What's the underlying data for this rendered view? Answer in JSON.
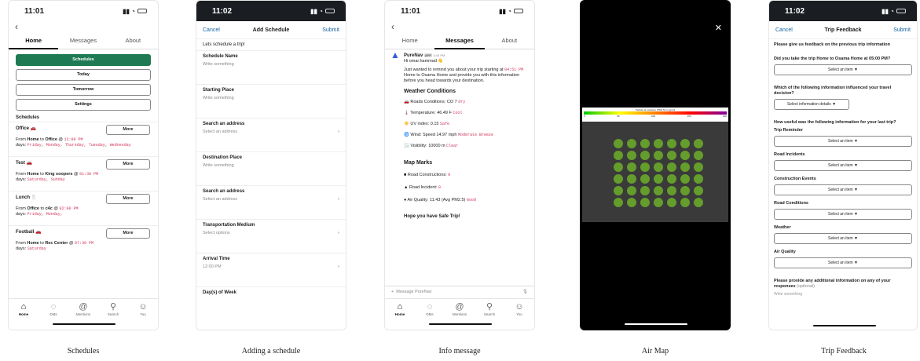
{
  "captions": [
    "Schedules",
    "Adding a schedule",
    "Info message",
    "Air Map",
    "Trip Feedback"
  ],
  "screen1": {
    "time": "11:01",
    "tabs": [
      "Home",
      "Messages",
      "About"
    ],
    "buttons": [
      "Schedules",
      "Today",
      "Tomorrow",
      "Settings"
    ],
    "section": "Schedules",
    "more": "More",
    "items": [
      {
        "title": "Office 🚗",
        "from": "From ",
        "a": "Home",
        "to": " to ",
        "b": "Office",
        "at": " @ ",
        "time": "12:00 PM",
        "days": "Friday, Monday, Thursday, Tuesday, Wednesday"
      },
      {
        "title": "Test 🚗",
        "from": "From ",
        "a": "Home",
        "to": " to ",
        "b": "King soopers",
        "at": " @ ",
        "time": "01:30 PM",
        "days": "Saturday, Sunday"
      },
      {
        "title": "Lunch 🍴",
        "from": "From ",
        "a": "Office",
        "to": " to ",
        "b": "c4c",
        "at": " @ ",
        "time": "02:00 PM",
        "days": "Friday, Monday,"
      },
      {
        "title": "Football 🚗",
        "from": "From ",
        "a": "Home",
        "to": " to ",
        "b": "Rec Center",
        "at": " @ ",
        "time": "07:30 PM",
        "days": "Saturday"
      }
    ],
    "days_label": "days: "
  },
  "nav": [
    {
      "icon": "home-icon",
      "label": "Home"
    },
    {
      "icon": "dms-icon",
      "label": "DMs"
    },
    {
      "icon": "mentions-icon",
      "label": "Mentions"
    },
    {
      "icon": "search-icon",
      "label": "Search"
    },
    {
      "icon": "you-icon",
      "label": "You"
    }
  ],
  "screen2": {
    "time": "11:02",
    "cancel": "Cancel",
    "title": "Add Schedule",
    "submit": "Submit",
    "intro": "Lets schedule a trip!",
    "fields": [
      {
        "label": "Schedule Name",
        "value": "Write something"
      },
      {
        "label": "Starting Place",
        "value": "Write something"
      },
      {
        "label": "Search an address",
        "value": "Select an address",
        "arrow": true
      },
      {
        "label": "Destination Place",
        "value": "Write something"
      },
      {
        "label": "Search an address",
        "value": "Select an address",
        "arrow": true
      },
      {
        "label": "Transportation Medium",
        "value": "Select options",
        "arrow": true
      },
      {
        "label": "Arrival Time",
        "value": "12:00 PM",
        "arrow": true
      },
      {
        "label": "Day(s) of Week",
        "value": ""
      }
    ]
  },
  "screen3": {
    "time": "11:01",
    "tabs": [
      "Home",
      "Messages",
      "About"
    ],
    "sender": "PureNav",
    "app": "APP",
    "stamp": "4:43 PM",
    "greeting": "Hi omar.hammad 👋",
    "body1": "Just wanted to remind you about your trip starting at ",
    "t": "04:51 PM",
    "body2": " Home to Osama Home and provide you with this information before you head towards your destination.",
    "weather_h": "Weather Conditions",
    "weather": [
      {
        "label": "🚗 Roads Conditions: ",
        "v": "CO 7",
        "tag": "dry"
      },
      {
        "label": "🌡️ Temperature: ",
        "v": "46.49 F",
        "tag": "Cool"
      },
      {
        "label": "☀️ UV index: ",
        "v": "0.15",
        "tag": "Safe"
      },
      {
        "label": "🌀 Wind: ",
        "v": "Speed 14.97 mph",
        "tag": "Moderate Breeze"
      },
      {
        "label": "🌫️ Visibility: ",
        "v": "10000 m",
        "tag": "Clear"
      }
    ],
    "map_h": "Map Marks",
    "marks": [
      {
        "label": "■ Road Constructions: ",
        "tag": "0"
      },
      {
        "label": "▲ Road Incident: ",
        "tag": "0"
      },
      {
        "label": "● Air Quality: ",
        "v": "11.43 (Avg PM2.5)",
        "tag": "Good"
      }
    ],
    "closing": "Hope you have Safe Trip!",
    "placeholder": "Message PureNav"
  },
  "screen4": {
    "legend": "Particle air pollution (PM2.5) in μg/m3",
    "ticks": [
      "0",
      "50",
      "100",
      "150",
      "200"
    ]
  },
  "screen5": {
    "time": "11:02",
    "cancel": "Cancel",
    "title": "Trip Feedback",
    "submit": "Submit",
    "q0": "Please give us feedback on the previous trip information",
    "q1": "Did you take the trip Home to Osama Home at 05:00 PM?",
    "sel": "Select an item ▼",
    "q2": "Which of the following information influenced your travel decision?",
    "sel2": "Select information details ▼",
    "q3": "How useful was the following information for your last trip?",
    "items": [
      "Trip Reminder",
      "Road Incidents",
      "Construction Events",
      "Road Conditions",
      "Weather",
      "Air Quality"
    ],
    "q4": "Please provide any additional information on any of your responses",
    "opt": "(optional)",
    "write": "Write something"
  }
}
